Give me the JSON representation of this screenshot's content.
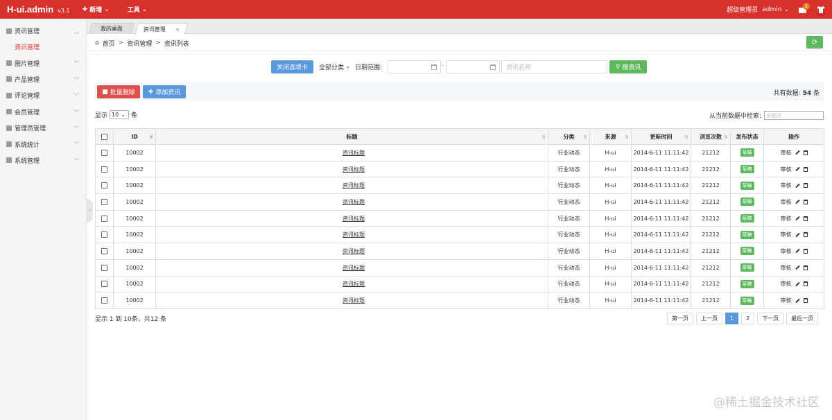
{
  "topbar": {
    "brand": "H-ui.admin",
    "version": "v3.1",
    "menu_new": "新增",
    "menu_tools": "工具",
    "role": "超级管理员",
    "user": "admin",
    "msg_count": "1"
  },
  "sidebar": {
    "items": [
      {
        "label": "资讯管理"
      },
      {
        "label": "图片管理"
      },
      {
        "label": "产品管理"
      },
      {
        "label": "评论管理"
      },
      {
        "label": "会员管理"
      },
      {
        "label": "管理员管理"
      },
      {
        "label": "系统统计"
      },
      {
        "label": "系统管理"
      }
    ],
    "active_sub": "资讯管理"
  },
  "tabs": [
    {
      "label": "我的桌面"
    },
    {
      "label": "资讯管理"
    }
  ],
  "breadcrumb": {
    "home": "首页",
    "level1": "资讯管理",
    "level2": "资讯列表",
    "sep": ">"
  },
  "search": {
    "close_tab_btn": "关闭选项卡",
    "category": "全部分类",
    "date_label": "日期范围:",
    "date_sep": "-",
    "name_placeholder": "资讯名称",
    "search_btn": "搜资讯"
  },
  "toolbar": {
    "batch_delete": "批量删除",
    "add_news": "添加资讯",
    "total_prefix": "共有数据:",
    "total_count": "54",
    "total_suffix": "条"
  },
  "length": {
    "show": "显示",
    "value": "10",
    "unit": "条"
  },
  "filter": {
    "label": "从当前数据中检索:",
    "placeholder": "关键词"
  },
  "table": {
    "headers": {
      "id": "ID",
      "title": "标题",
      "category": "分类",
      "source": "来源",
      "updated": "更新时间",
      "views": "浏览次数",
      "status": "发布状态",
      "ops": "操作"
    },
    "rows": [
      {
        "id": "10002",
        "title": "资讯标题",
        "category": "行业动态",
        "source": "H-ui",
        "updated": "2014-6-11 11:11:42",
        "views": "21212",
        "status": "草稿",
        "op": "审核"
      },
      {
        "id": "10002",
        "title": "资讯标题",
        "category": "行业动态",
        "source": "H-ui",
        "updated": "2014-6-11 11:11:42",
        "views": "21212",
        "status": "草稿",
        "op": "审核"
      },
      {
        "id": "10002",
        "title": "资讯标题",
        "category": "行业动态",
        "source": "H-ui",
        "updated": "2014-6-11 11:11:42",
        "views": "21212",
        "status": "草稿",
        "op": "审核"
      },
      {
        "id": "10002",
        "title": "资讯标题",
        "category": "行业动态",
        "source": "H-ui",
        "updated": "2014-6-11 11:11:42",
        "views": "21212",
        "status": "草稿",
        "op": "审核"
      },
      {
        "id": "10002",
        "title": "资讯标题",
        "category": "行业动态",
        "source": "H-ui",
        "updated": "2014-6-11 11:11:42",
        "views": "21212",
        "status": "草稿",
        "op": "审核"
      },
      {
        "id": "10002",
        "title": "资讯标题",
        "category": "行业动态",
        "source": "H-ui",
        "updated": "2014-6-11 11:11:42",
        "views": "21212",
        "status": "草稿",
        "op": "审核"
      },
      {
        "id": "10002",
        "title": "资讯标题",
        "category": "行业动态",
        "source": "H-ui",
        "updated": "2014-6-11 11:11:42",
        "views": "21212",
        "status": "草稿",
        "op": "审核"
      },
      {
        "id": "10002",
        "title": "资讯标题",
        "category": "行业动态",
        "source": "H-ui",
        "updated": "2014-6-11 11:11:42",
        "views": "21212",
        "status": "草稿",
        "op": "审核"
      },
      {
        "id": "10002",
        "title": "资讯标题",
        "category": "行业动态",
        "source": "H-ui",
        "updated": "2014-6-11 11:11:42",
        "views": "21212",
        "status": "草稿",
        "op": "审核"
      },
      {
        "id": "10002",
        "title": "资讯标题",
        "category": "行业动态",
        "source": "H-ui",
        "updated": "2014-6-11 11:11:42",
        "views": "21212",
        "status": "草稿",
        "op": "审核"
      }
    ]
  },
  "footer": {
    "info": "显示 1 到 10条，共12 条",
    "pager": {
      "first": "第一页",
      "prev": "上一页",
      "p1": "1",
      "p2": "2",
      "next": "下一页",
      "last": "最后一页"
    }
  },
  "watermark": "@稀土掘金技术社区",
  "colors": {
    "brand_red": "#d8302c",
    "primary_blue": "#5a98de",
    "success_green": "#5eb95e",
    "danger_red": "#dd514c"
  }
}
